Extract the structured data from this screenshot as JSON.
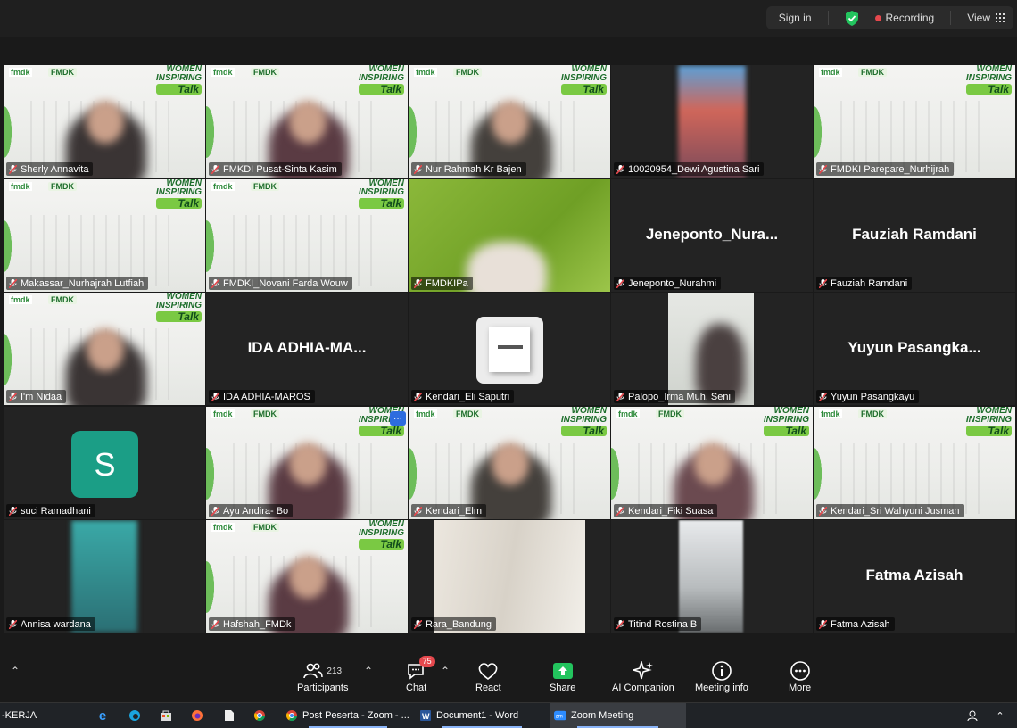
{
  "topbar": {
    "sign_in": "Sign in",
    "recording": "Recording",
    "view": "View"
  },
  "tiles": [
    {
      "name": "Sherly Annavita",
      "type": "banner",
      "active": true
    },
    {
      "name": "FMKDI Pusat-Sinta Kasim",
      "type": "banner"
    },
    {
      "name": "Nur Rahmah Kr Bajen",
      "type": "banner"
    },
    {
      "name": "10020954_Dewi Agustina Sari",
      "type": "photo"
    },
    {
      "name": "FMDKI Parepare_Nurhijrah",
      "type": "banner"
    },
    {
      "name": "Makassar_Nurhajrah Lutfiah",
      "type": "banner"
    },
    {
      "name": "FMDKI_Novani Farda Wouw",
      "type": "banner"
    },
    {
      "name": "FMDKIPa",
      "type": "green"
    },
    {
      "name": "Jeneponto_Nurahmi",
      "type": "text",
      "display": "Jeneponto_Nura..."
    },
    {
      "name": "Fauziah Ramdani",
      "type": "text",
      "display": "Fauziah Ramdani"
    },
    {
      "name": "I'm Nidaa",
      "type": "banner"
    },
    {
      "name": "IDA ADHIA-MAROS",
      "type": "text",
      "display": "IDA  ADHIA-MA..."
    },
    {
      "name": "Kendari_Eli Saputri",
      "type": "profile"
    },
    {
      "name": "Palopo_Irma Muh. Seni",
      "type": "photo2"
    },
    {
      "name": "Yuyun Pasangkayu",
      "type": "text",
      "display": "Yuyun  Pasangka..."
    },
    {
      "name": "suci Ramadhani",
      "type": "avatar",
      "initial": "S"
    },
    {
      "name": "Ayu Andira- Bo",
      "type": "banner",
      "more": "···"
    },
    {
      "name": "Kendari_Elm",
      "type": "banner"
    },
    {
      "name": "Kendari_Fiki Suasa",
      "type": "banner"
    },
    {
      "name": "Kendari_Sri Wahyuni Jusman",
      "type": "banner"
    },
    {
      "name": "Annisa wardana",
      "type": "teal"
    },
    {
      "name": "Hafshah_FMDk",
      "type": "banner"
    },
    {
      "name": "Rara_Bandung",
      "type": "wall"
    },
    {
      "name": "Titind Rostina B",
      "type": "outdoor"
    },
    {
      "name": "Fatma Azisah",
      "type": "text",
      "display": "Fatma Azisah"
    }
  ],
  "banner": {
    "logo_a": "fmdk",
    "logo_b": "FMDK",
    "wit_1": "WOMEN",
    "wit_2": "INSPIRING",
    "wit_3": "Talk"
  },
  "toolbar": {
    "participants": "Participants",
    "participants_count": "213",
    "chat": "Chat",
    "chat_badge": "75",
    "react": "React",
    "share": "Share",
    "ai": "AI Companion",
    "info": "Meeting info",
    "more": "More"
  },
  "taskbar": {
    "left": "-KERJA",
    "chrome_tab": "Post Peserta - Zoom - ...",
    "word": "Document1 - Word",
    "zoom": "Zoom Meeting"
  },
  "colors": {
    "active": "#35c46b",
    "recording": "#e5484d",
    "avatar": "#1b9e86",
    "share": "#23c45e"
  }
}
